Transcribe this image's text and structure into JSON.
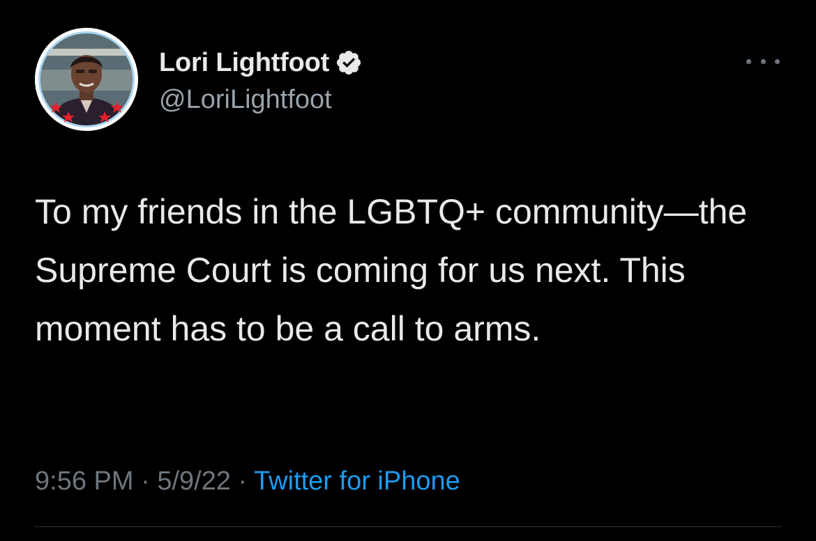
{
  "tweet": {
    "display_name": "Lori Lightfoot",
    "handle": "@LoriLightfoot",
    "verified_icon": "verified-badge-icon",
    "more_icon": "more-options-icon",
    "text": "To my friends in the LGBTQ+ community—the Supreme Court is coming for us next. This moment has to be a call to arms.",
    "time": "9:56 PM",
    "date": "5/9/22",
    "separator": "·",
    "source": "Twitter for iPhone"
  },
  "colors": {
    "background": "#000000",
    "text_primary": "#e7e9ea",
    "text_secondary": "#6e767d",
    "link": "#1d9bf0"
  }
}
